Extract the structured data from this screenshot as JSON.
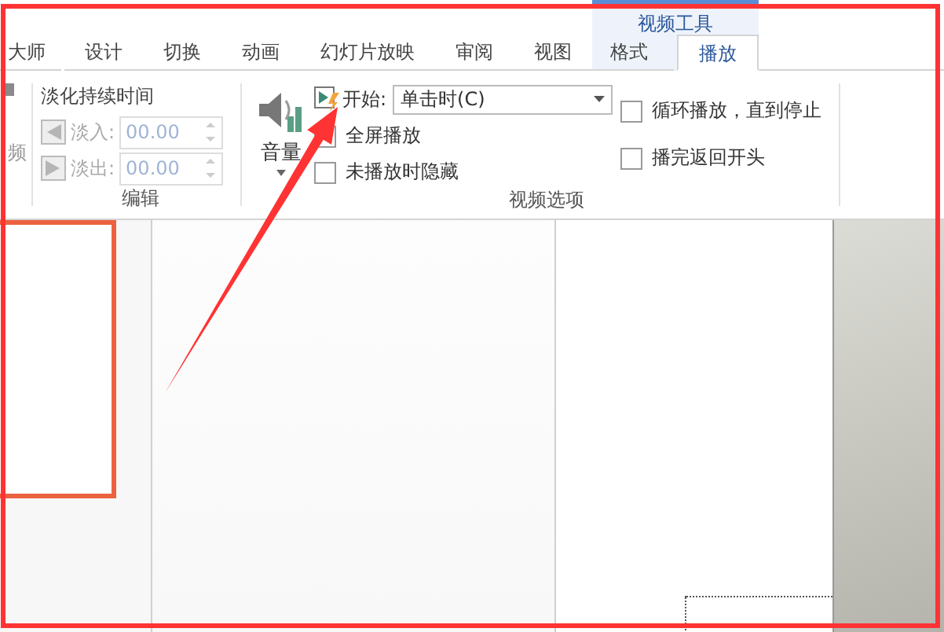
{
  "tabs": [
    {
      "label": "大师",
      "selected": false
    },
    {
      "label": "设计",
      "selected": false
    },
    {
      "label": "切换",
      "selected": false
    },
    {
      "label": "动画",
      "selected": false
    },
    {
      "label": "幻灯片放映",
      "selected": false
    },
    {
      "label": "审阅",
      "selected": false
    },
    {
      "label": "视图",
      "selected": false
    }
  ],
  "contextual_group": {
    "title": "视频工具",
    "tabs": [
      {
        "label": "格式",
        "selected": false
      },
      {
        "label": "播放",
        "selected": true
      }
    ]
  },
  "partial_group": {
    "label": "频"
  },
  "fade_group": {
    "title": "淡化持续时间",
    "label": "编辑",
    "fields": [
      {
        "label": "淡入:",
        "value": "00.00",
        "disabled": true
      },
      {
        "label": "淡出:",
        "value": "00.00",
        "disabled": true
      }
    ]
  },
  "video_options": {
    "label": "视频选项",
    "volume": "音量",
    "start": {
      "label": "开始:",
      "value": "单击时(C)"
    },
    "checkboxes_left": [
      {
        "label": "全屏播放",
        "checked": false
      },
      {
        "label": "未播放时隐藏",
        "checked": false
      }
    ],
    "checkboxes_right": [
      {
        "label": "循环播放，直到停止",
        "checked": false
      },
      {
        "label": "播完返回开头",
        "checked": false
      }
    ]
  }
}
